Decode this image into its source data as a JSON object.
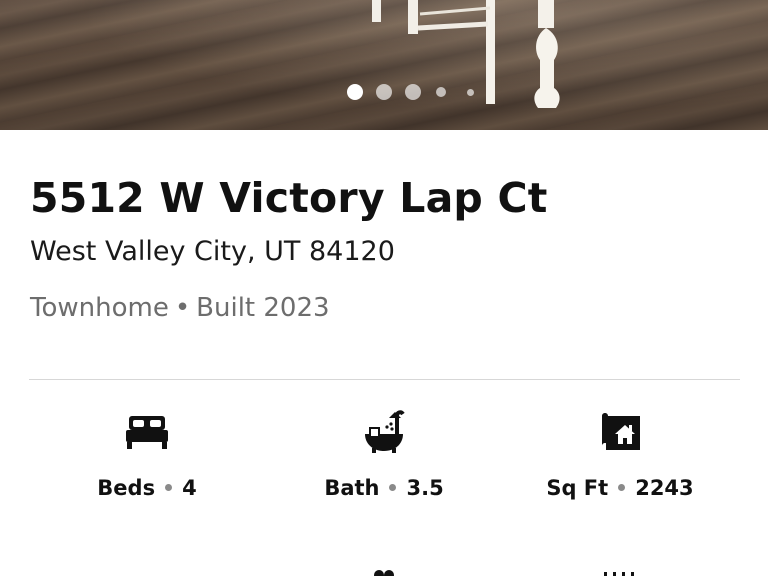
{
  "listing": {
    "address": "5512 W Victory Lap Ct",
    "city_line": "West Valley City, UT 84120",
    "property_type": "Townhome",
    "separator": "•",
    "built": "Built 2023"
  },
  "gallery": {
    "dot_count": 5,
    "active_index": 0
  },
  "stats": [
    {
      "icon": "bed-icon",
      "label": "Beds",
      "value": "4"
    },
    {
      "icon": "bath-icon",
      "label": "Bath",
      "value": "3.5"
    },
    {
      "icon": "floorplan-icon",
      "label": "Sq Ft",
      "value": "2243"
    }
  ],
  "colors": {
    "text": "#111111",
    "secondary": "#6d6d6d",
    "divider": "#d7d7d7"
  }
}
